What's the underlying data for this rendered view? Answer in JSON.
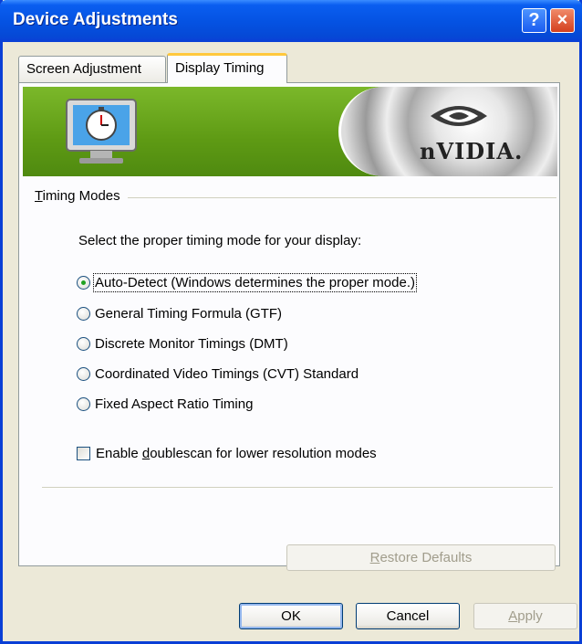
{
  "window": {
    "title": "Device Adjustments",
    "help_label": "?",
    "close_label": "×"
  },
  "tabs": [
    {
      "label": "Screen Adjustment",
      "active": false
    },
    {
      "label": "Display Timing",
      "active": true
    }
  ],
  "banner": {
    "brand_text": "nVIDIA.",
    "colors": {
      "green": "#5e9a14",
      "title_blue": "#0553e3"
    }
  },
  "timing_modes": {
    "group_label_first": "T",
    "group_label_rest": "iming Modes",
    "prompt": "Select the proper timing mode for your display:",
    "options": [
      {
        "label": "Auto-Detect (Windows determines the proper mode.)",
        "checked": true
      },
      {
        "label": "General Timing Formula (GTF)",
        "checked": false
      },
      {
        "label": "Discrete Monitor Timings (DMT)",
        "checked": false
      },
      {
        "label": "Coordinated Video Timings (CVT) Standard",
        "checked": false
      },
      {
        "label": "Fixed Aspect Ratio Timing",
        "checked": false
      }
    ],
    "doublescan": {
      "label_pre": "Enable ",
      "label_underline": "d",
      "label_post": "oublescan for lower resolution modes",
      "checked": false
    }
  },
  "buttons": {
    "restore_underline": "R",
    "restore_rest": "estore Defaults",
    "ok": "OK",
    "cancel": "Cancel",
    "apply_underline": "A",
    "apply_rest": "pply"
  }
}
